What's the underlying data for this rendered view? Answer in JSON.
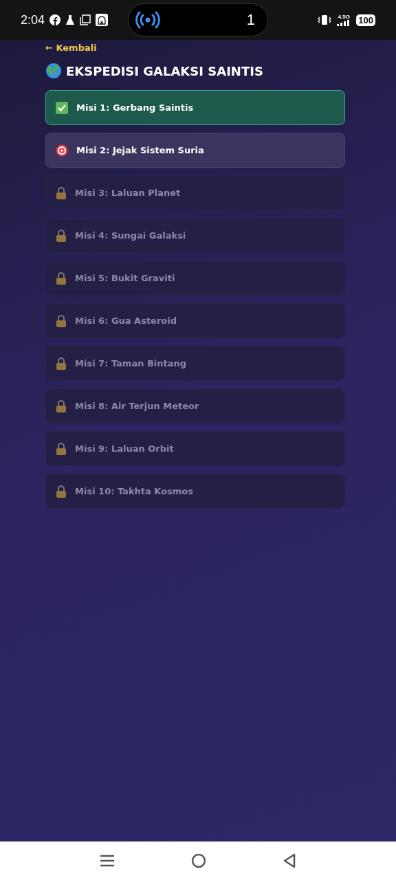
{
  "status_bar": {
    "time": "2:04",
    "pill_count": "1",
    "network": "4.5G",
    "battery": "100"
  },
  "back_link": "← Kembali",
  "title": "EKSPEDISI GALAKSI SAINTIS",
  "missions": [
    {
      "label": "Misi 1: Gerbang Saintis",
      "kind": "done"
    },
    {
      "label": "Misi 2: Jejak Sistem Suria",
      "kind": "current"
    },
    {
      "label": "Misi 3: Laluan Planet",
      "kind": "locked"
    },
    {
      "label": "Misi 4: Sungai Galaksi",
      "kind": "locked"
    },
    {
      "label": "Misi 5: Bukit Graviti",
      "kind": "locked"
    },
    {
      "label": "Misi 6: Gua Asteroid",
      "kind": "locked"
    },
    {
      "label": "Misi 7: Taman Bintang",
      "kind": "locked"
    },
    {
      "label": "Misi 8: Air Terjun Meteor",
      "kind": "locked"
    },
    {
      "label": "Misi 9: Laluan Orbit",
      "kind": "locked"
    },
    {
      "label": "Misi 10: Takhta Kosmos",
      "kind": "locked"
    }
  ]
}
